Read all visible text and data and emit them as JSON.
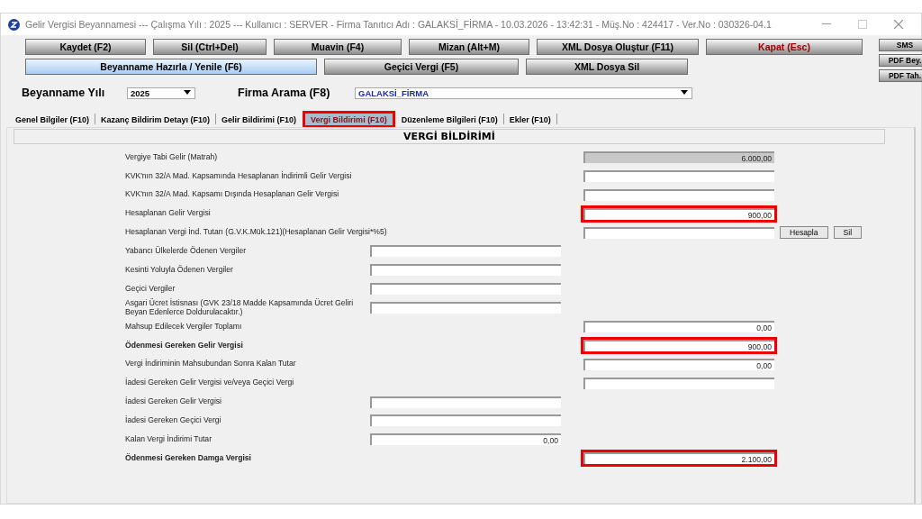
{
  "window": {
    "title": "Gelir Vergisi Beyannamesi  ---  Çalışma Yılı : 2025  ---  Kullanıcı : SERVER - Firma Tanıtıcı Adı : GALAKSİ_FİRMA - 10.03.2026 - 13:42:31 - Müş.No : 424417 - Ver.No : 030326-04.1"
  },
  "toolbar": {
    "top_row": [
      {
        "label": "Kaydet (F2)",
        "selected": false,
        "danger": false
      },
      {
        "label": "Sil (Ctrl+Del)",
        "selected": false,
        "danger": false
      },
      {
        "label": "Muavin (F4)",
        "selected": false,
        "danger": false
      },
      {
        "label": "Mizan (Alt+M)",
        "selected": false,
        "danger": false
      },
      {
        "label": "XML Dosya Oluştur (F11)",
        "selected": false,
        "danger": false
      },
      {
        "label": "Kapat (Esc)",
        "selected": false,
        "danger": true
      }
    ],
    "bottom_row": [
      {
        "label": "Beyanname Hazırla / Yenile (F6)",
        "selected": true,
        "danger": false
      },
      {
        "label": "Geçici Vergi (F5)",
        "selected": false,
        "danger": false
      },
      {
        "label": "XML Dosya Sil",
        "selected": false,
        "danger": false
      }
    ],
    "side_buttons": [
      "SMS",
      "PDF Bey.",
      "PDF Tah."
    ]
  },
  "filters": [
    {
      "label": "Beyanname Yılı",
      "value": "2025"
    },
    {
      "label": "Firma Arama (F8)",
      "value": "GALAKSİ_FİRMA"
    }
  ],
  "tabs": [
    {
      "label": "Genel Bilgiler (F10)",
      "selected": false
    },
    {
      "label": "Kazanç Bildirim Detayı (F10)",
      "selected": false
    },
    {
      "label": "Gelir Bildirimi (F10)",
      "selected": false
    },
    {
      "label": "Vergi Bildirimi (F10)",
      "selected": true
    },
    {
      "label": "Düzenleme Bilgileri (F10)",
      "selected": false
    },
    {
      "label": "Ekler (F10)",
      "selected": false
    }
  ],
  "section": {
    "title": "VERGİ BİLDİRİMİ"
  },
  "rows": [
    {
      "label": "Vergiye Tabi Gelir (Matrah)",
      "bold": false,
      "right_field": {
        "value": "6.000,00",
        "readonly": true,
        "highlighted": false
      }
    },
    {
      "label": "KVK'nın 32/A Mad. Kapsamında Hesaplanan İndirimli Gelir Vergisi",
      "bold": false,
      "right_field": {
        "readonly": false,
        "highlighted": false
      }
    },
    {
      "label": "KVK'nın 32/A Mad. Kapsamı Dışında Hesaplanan Gelir Vergisi",
      "bold": false,
      "right_field": {
        "readonly": false,
        "highlighted": false
      }
    },
    {
      "label": "Hesaplanan Gelir Vergisi",
      "bold": false,
      "right_field": {
        "value": "900,00",
        "readonly": false,
        "highlighted": true
      }
    },
    {
      "label": "Hesaplanan Vergi İnd. Tutarı (G.V.K.Mük.121)(Hesaplanan Gelir Vergisi*%5)",
      "bold": false,
      "right_field": {
        "readonly": false,
        "highlighted": false
      },
      "buttons": [
        "Hesapla",
        "Sil"
      ]
    },
    {
      "label": "Yabancı Ülkelerde Ödenen Vergiler",
      "bold": false,
      "left_field": {
        "readonly": false,
        "highlighted": false
      }
    },
    {
      "label": "Kesinti Yoluyla Ödenen Vergiler",
      "bold": false,
      "left_field": {
        "readonly": false,
        "highlighted": false
      }
    },
    {
      "label": "Geçici Vergiler",
      "bold": false,
      "left_field": {
        "readonly": false,
        "highlighted": false
      }
    },
    {
      "label": "Asgari Ücret İstisnası (GVK 23/18 Madde Kapsamında Ücret Geliri Beyan Edenlerce Doldurulacaktır.)",
      "bold": false,
      "left_field": {
        "readonly": false,
        "highlighted": false
      }
    },
    {
      "label": "Mahsup Edilecek Vergiler Toplamı",
      "bold": false,
      "right_field": {
        "value": "0,00",
        "readonly": false,
        "highlighted": false
      }
    },
    {
      "label": "Ödenmesi Gereken Gelir Vergisi",
      "bold": true,
      "right_field": {
        "value": "900,00",
        "readonly": false,
        "highlighted": true
      }
    },
    {
      "label": "Vergi İndiriminin Mahsubundan Sonra Kalan Tutar",
      "bold": false,
      "right_field": {
        "value": "0,00",
        "readonly": false,
        "highlighted": false
      }
    },
    {
      "label": "İadesi Gereken Gelir Vergisi ve/veya Geçici Vergi",
      "bold": false,
      "right_field": {
        "readonly": false,
        "highlighted": false
      }
    },
    {
      "label": "İadesi Gereken Gelir Vergisi",
      "bold": false,
      "left_field": {
        "readonly": false,
        "highlighted": false
      }
    },
    {
      "label": "İadesi Gereken Geçici Vergi",
      "bold": false,
      "left_field": {
        "readonly": false,
        "highlighted": false
      }
    },
    {
      "label": "Kalan Vergi İndirimi Tutar",
      "bold": false,
      "left_field": {
        "value": "0,00",
        "readonly": false,
        "highlighted": false
      }
    },
    {
      "label": "Ödenmesi Gereken Damga Vergisi",
      "bold": true,
      "right_field": {
        "value": "2.100,00",
        "readonly": false,
        "highlighted": true
      }
    }
  ]
}
